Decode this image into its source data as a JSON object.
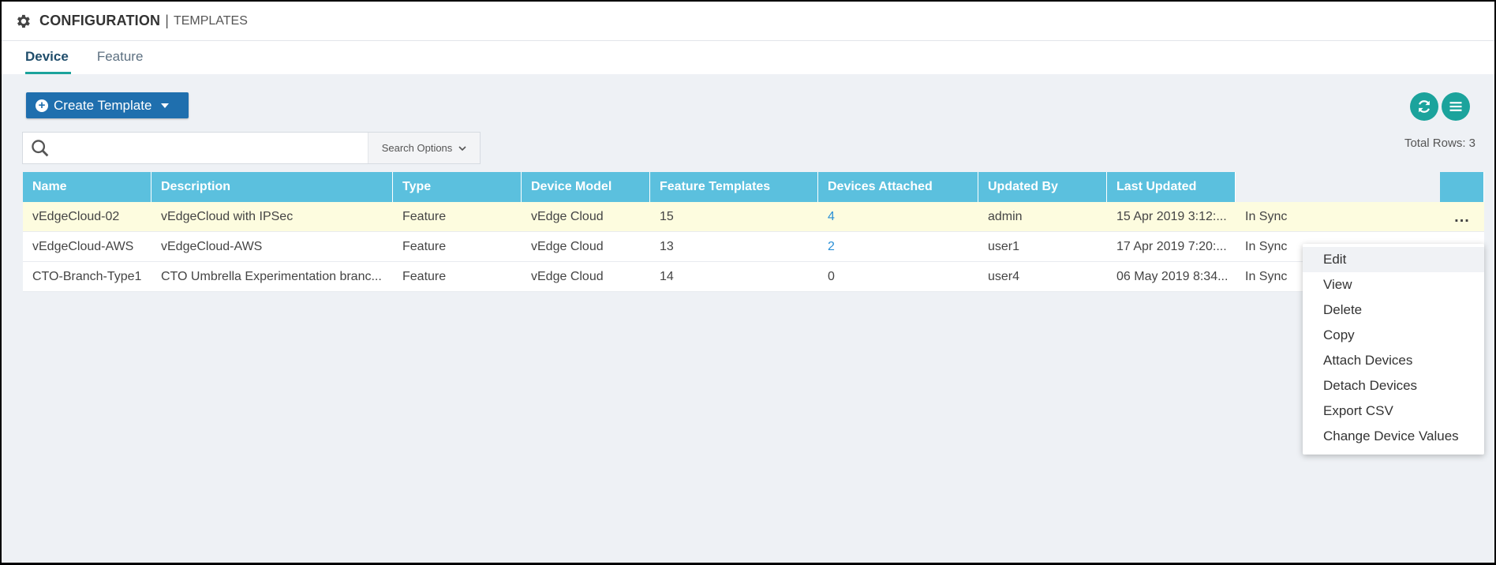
{
  "header": {
    "title_main": "CONFIGURATION",
    "separator": "|",
    "title_sub": "TEMPLATES"
  },
  "tabs": [
    {
      "label": "Device",
      "active": true
    },
    {
      "label": "Feature",
      "active": false
    }
  ],
  "toolbar": {
    "create_label": "Create Template",
    "refresh_icon": "refresh-icon",
    "menu_icon": "list-menu-icon"
  },
  "search": {
    "placeholder": "",
    "options_label": "Search Options"
  },
  "total_rows": "Total Rows: 3",
  "table": {
    "columns": [
      "Name",
      "Description",
      "Type",
      "Device Model",
      "Feature Templates",
      "Devices Attached",
      "Updated By",
      "Last Updated"
    ],
    "rows": [
      {
        "name": "vEdgeCloud-02",
        "description": "vEdgeCloud with IPSec",
        "type": "Feature",
        "model": "vEdge Cloud",
        "feature_templates": "15",
        "devices_attached": "4",
        "updated_by": "admin",
        "last_updated": "15 Apr 2019 3:12:...",
        "status": "In Sync",
        "more": "..."
      },
      {
        "name": "vEdgeCloud-AWS",
        "description": "vEdgeCloud-AWS",
        "type": "Feature",
        "model": "vEdge Cloud",
        "feature_templates": "13",
        "devices_attached": "2",
        "updated_by": "user1",
        "last_updated": "17 Apr 2019 7:20:...",
        "status": "In Sync"
      },
      {
        "name": "CTO-Branch-Type1",
        "description": "CTO Umbrella Experimentation branc...",
        "type": "Feature",
        "model": "vEdge Cloud",
        "feature_templates": "14",
        "devices_attached": "0",
        "updated_by": "user4",
        "last_updated": "06 May 2019 8:34...",
        "status": "In Sync"
      }
    ]
  },
  "context_menu": {
    "items": [
      "Edit",
      "View",
      "Delete",
      "Copy",
      "Attach Devices",
      "Detach Devices",
      "Export CSV",
      "Change Device Values"
    ]
  },
  "colors": {
    "accent": "#1ba39c",
    "primary_button": "#1f6fae",
    "table_header": "#5bc0de",
    "link": "#2a8fd6",
    "selected_row": "#fdfcdf"
  }
}
